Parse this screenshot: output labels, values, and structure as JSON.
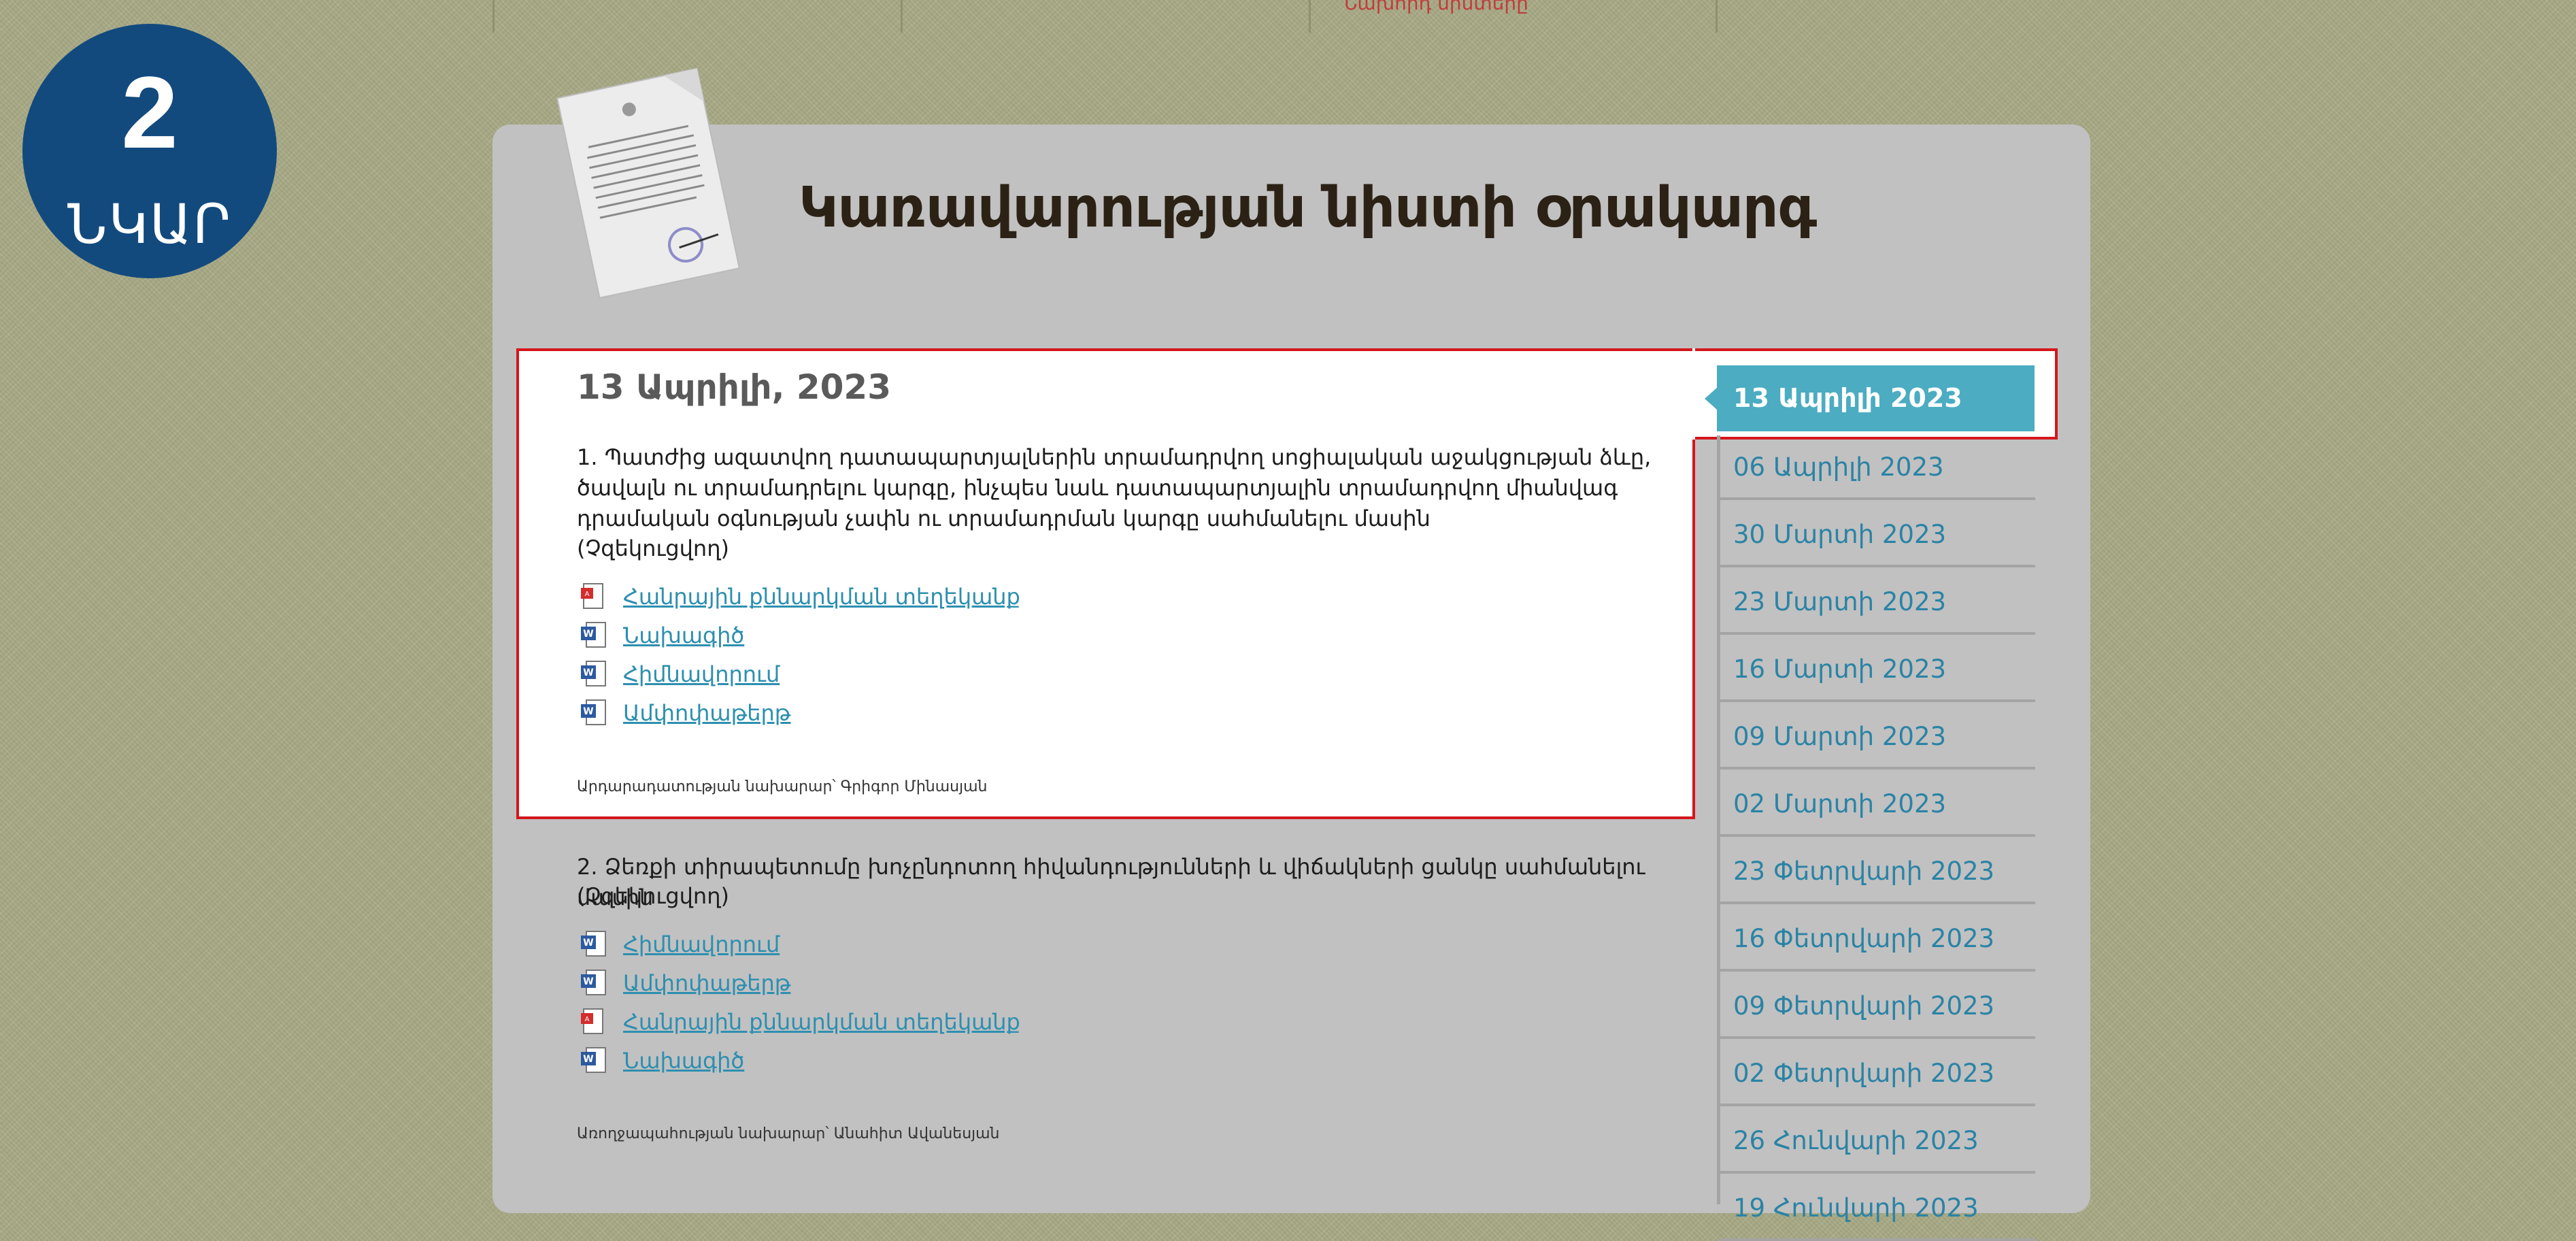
{
  "top_nav": {
    "link": "Նախորդ նիստերը"
  },
  "badge": {
    "number": "2",
    "label": "ՆԿԱՐ"
  },
  "page_title": "Կառավարության նիստի օրակարգ",
  "selected_date_heading": "13 Ապրիլի, 2023",
  "items": [
    {
      "text": "1. Պատժից ազատվող դատապարտյալներին տրամադրվող սոցիալական աջակցության ձևը, ծավալն ու տրամադրելու կարգը, ինչպես նաև դատապարտյալին տրամադրվող միանվագ դրամական օգնության չափն ու տրամադրման կարգը սահմանելու մասին",
      "status": "(Չզեկուցվող)",
      "files": [
        {
          "type": "pdf",
          "label": "Հանրային քննարկման տեղեկանք"
        },
        {
          "type": "word",
          "label": "Նախագիծ"
        },
        {
          "type": "word",
          "label": "Հիմնավորում"
        },
        {
          "type": "word",
          "label": "Ամփոփաթերթ"
        }
      ],
      "minister": "Արդարադատության նախարար՝ Գրիգոր Մինասյան"
    },
    {
      "text": "2. Ձեռքի տիրապետումը խոչընդոտող հիվանդությունների և վիճակների ցանկը սահմանելու մասին",
      "status": "(Չզեկուցվող)",
      "files": [
        {
          "type": "word",
          "label": "Հիմնավորում"
        },
        {
          "type": "word",
          "label": "Ամփոփաթերթ"
        },
        {
          "type": "pdf",
          "label": "Հանրային քննարկման տեղեկանք"
        },
        {
          "type": "word",
          "label": "Նախագիծ"
        }
      ],
      "minister": "Առողջապահության նախարար՝ Անահիտ Ավանեսյան"
    }
  ],
  "sidebar": {
    "active": "13 Ապրիլի 2023",
    "dates": [
      "06 Ապրիլի 2023",
      "30 Մարտի 2023",
      "23 Մարտի 2023",
      "16 Մարտի 2023",
      "09 Մարտի 2023",
      "02 Մարտի 2023",
      "23 Փետրվարի 2023",
      "16 Փետրվարի 2023",
      "09 Փետրվարի 2023",
      "02 Փետրվարի 2023",
      "26 Հունվարի 2023",
      "19 Հունվարի 2023"
    ]
  },
  "colors": {
    "highlight": "#d4161c",
    "accent": "#4cacc1",
    "link": "#2d8fb0",
    "badge": "#124a7e"
  }
}
